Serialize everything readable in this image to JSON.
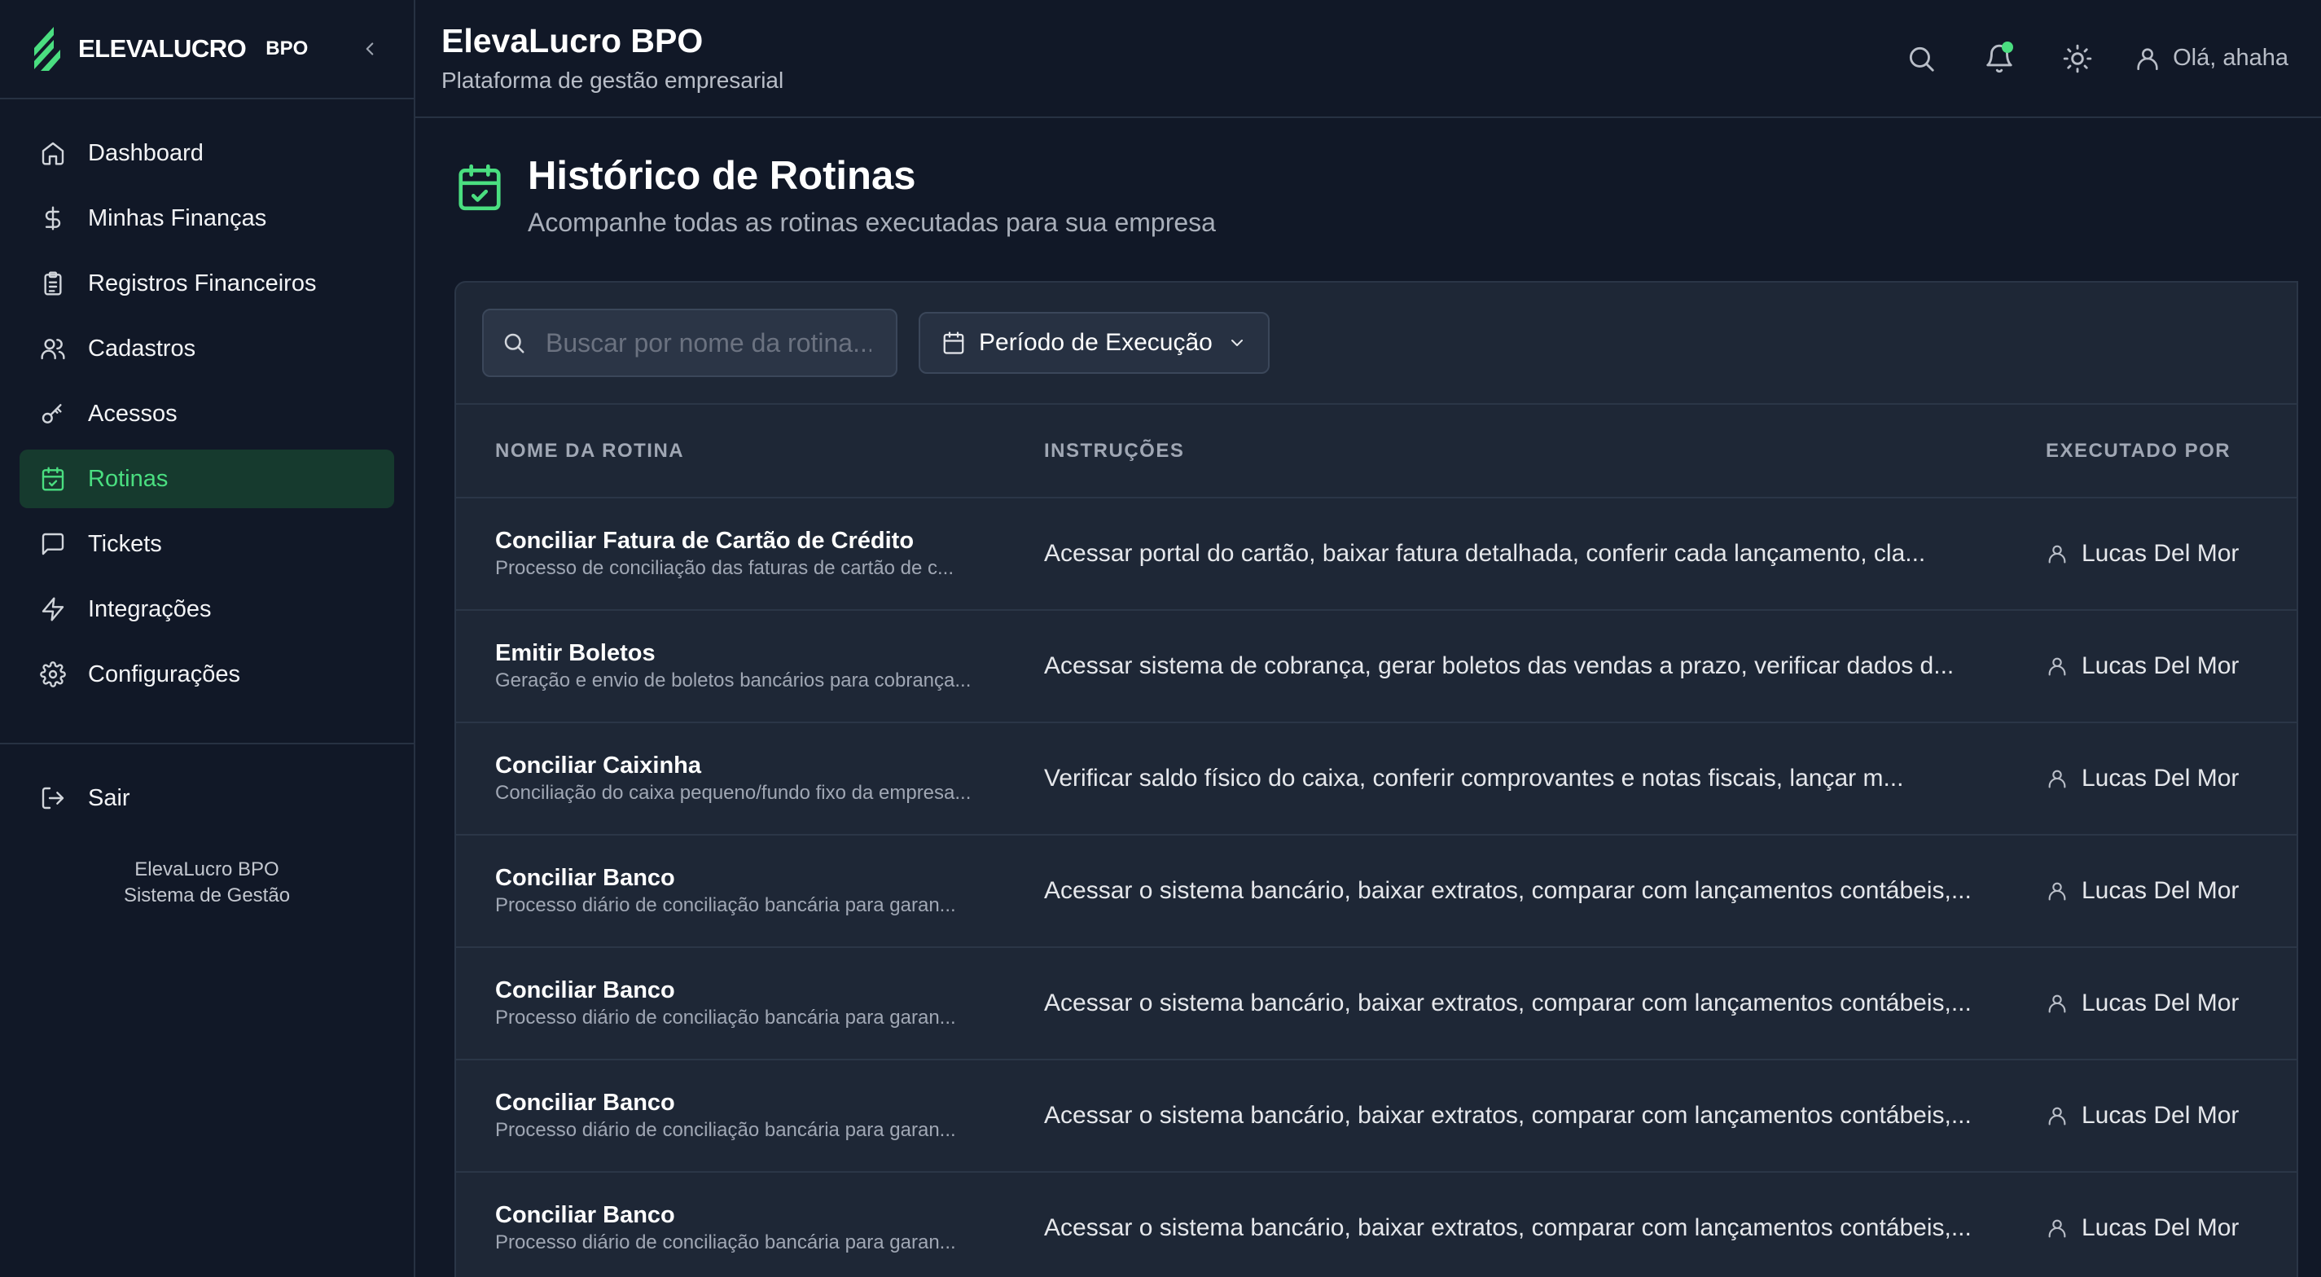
{
  "brand": {
    "name": "ELEVALUCRO",
    "tag": "BPO",
    "accent": "#4ade80"
  },
  "sidebar": {
    "items": [
      {
        "label": "Dashboard",
        "icon": "home-icon"
      },
      {
        "label": "Minhas Finanças",
        "icon": "dollar-icon"
      },
      {
        "label": "Registros Financeiros",
        "icon": "clipboard-icon"
      },
      {
        "label": "Cadastros",
        "icon": "users-icon"
      },
      {
        "label": "Acessos",
        "icon": "key-icon"
      },
      {
        "label": "Rotinas",
        "icon": "calendar-check-icon",
        "active": true
      },
      {
        "label": "Tickets",
        "icon": "message-icon"
      },
      {
        "label": "Integrações",
        "icon": "zap-icon"
      },
      {
        "label": "Configurações",
        "icon": "gear-icon"
      }
    ],
    "logout_label": "Sair",
    "footer_line1": "ElevaLucro BPO",
    "footer_line2": "Sistema de Gestão"
  },
  "header": {
    "title": "ElevaLucro BPO",
    "subtitle": "Plataforma de gestão empresarial",
    "greeting": "Olá, ahaha"
  },
  "page": {
    "title": "Histórico de Rotinas",
    "subtitle": "Acompanhe todas as rotinas executadas para sua empresa"
  },
  "filters": {
    "search_placeholder": "Buscar por nome da rotina...",
    "period_label": "Período de Execução"
  },
  "table": {
    "columns": [
      "NOME DA ROTINA",
      "INSTRUÇÕES",
      "EXECUTADO POR"
    ],
    "rows": [
      {
        "name": "Conciliar Fatura de Cartão de Crédito",
        "desc": "Processo de conciliação das faturas de cartão de c...",
        "instructions": "Acessar portal do cartão, baixar fatura detalhada, conferir cada lançamento, cla...",
        "executor": "Lucas Del Mor"
      },
      {
        "name": "Emitir Boletos",
        "desc": "Geração e envio de boletos bancários para cobrança...",
        "instructions": "Acessar sistema de cobrança, gerar boletos das vendas a prazo, verificar dados d...",
        "executor": "Lucas Del Mor"
      },
      {
        "name": "Conciliar Caixinha",
        "desc": "Conciliação do caixa pequeno/fundo fixo da empresa...",
        "instructions": "Verificar saldo físico do caixa, conferir comprovantes e notas fiscais, lançar m...",
        "executor": "Lucas Del Mor"
      },
      {
        "name": "Conciliar Banco",
        "desc": "Processo diário de conciliação bancária para garan...",
        "instructions": "Acessar o sistema bancário, baixar extratos, comparar com lançamentos contábeis,...",
        "executor": "Lucas Del Mor"
      },
      {
        "name": "Conciliar Banco",
        "desc": "Processo diário de conciliação bancária para garan...",
        "instructions": "Acessar o sistema bancário, baixar extratos, comparar com lançamentos contábeis,...",
        "executor": "Lucas Del Mor"
      },
      {
        "name": "Conciliar Banco",
        "desc": "Processo diário de conciliação bancária para garan...",
        "instructions": "Acessar o sistema bancário, baixar extratos, comparar com lançamentos contábeis,...",
        "executor": "Lucas Del Mor"
      },
      {
        "name": "Conciliar Banco",
        "desc": "Processo diário de conciliação bancária para garan...",
        "instructions": "Acessar o sistema bancário, baixar extratos, comparar com lançamentos contábeis,...",
        "executor": "Lucas Del Mor"
      }
    ]
  }
}
